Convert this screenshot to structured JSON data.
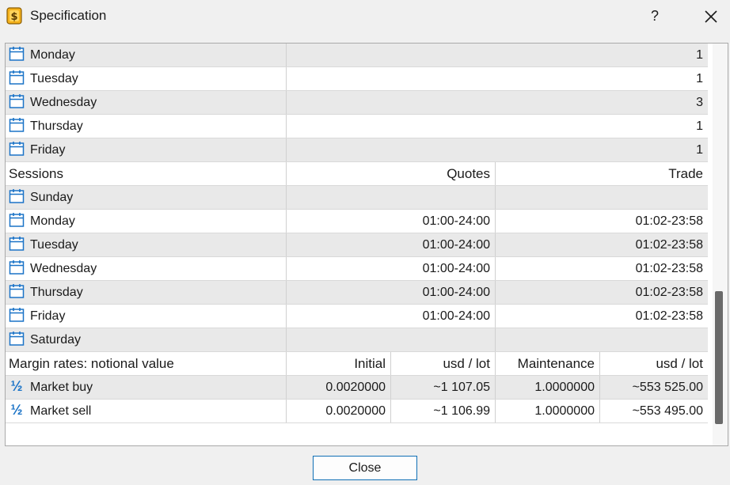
{
  "window": {
    "title": "Specification",
    "help_label": "?",
    "close_button_label": "Close"
  },
  "swap_days": [
    {
      "day": "Monday",
      "value": "1"
    },
    {
      "day": "Tuesday",
      "value": "1"
    },
    {
      "day": "Wednesday",
      "value": "3"
    },
    {
      "day": "Thursday",
      "value": "1"
    },
    {
      "day": "Friday",
      "value": "1"
    }
  ],
  "sessions": {
    "header": {
      "label": "Sessions",
      "quotes": "Quotes",
      "trade": "Trade"
    },
    "rows": [
      {
        "day": "Sunday",
        "quotes": "",
        "trade": ""
      },
      {
        "day": "Monday",
        "quotes": "01:00-24:00",
        "trade": "01:02-23:58"
      },
      {
        "day": "Tuesday",
        "quotes": "01:00-24:00",
        "trade": "01:02-23:58"
      },
      {
        "day": "Wednesday",
        "quotes": "01:00-24:00",
        "trade": "01:02-23:58"
      },
      {
        "day": "Thursday",
        "quotes": "01:00-24:00",
        "trade": "01:02-23:58"
      },
      {
        "day": "Friday",
        "quotes": "01:00-24:00",
        "trade": "01:02-23:58"
      },
      {
        "day": "Saturday",
        "quotes": "",
        "trade": ""
      }
    ]
  },
  "margin": {
    "header": {
      "label": "Margin rates: notional value",
      "initial": "Initial",
      "unit1": "usd / lot",
      "maintenance": "Maintenance",
      "unit2": "usd / lot"
    },
    "rows": [
      {
        "label": "Market buy",
        "initial": "0.0020000",
        "initial_usd": "~1 107.05",
        "maintenance": "1.0000000",
        "maintenance_usd": "~553 525.00"
      },
      {
        "label": "Market sell",
        "initial": "0.0020000",
        "initial_usd": "~1 106.99",
        "maintenance": "1.0000000",
        "maintenance_usd": "~553 495.00"
      }
    ]
  },
  "icons": {
    "calendar": "calendar-icon",
    "fraction": "one-half-icon",
    "app": "dollar-app-icon"
  },
  "colors": {
    "accent": "#1a73c7",
    "alt_row": "#e9e9e9",
    "button_border": "#0f6fb5"
  }
}
